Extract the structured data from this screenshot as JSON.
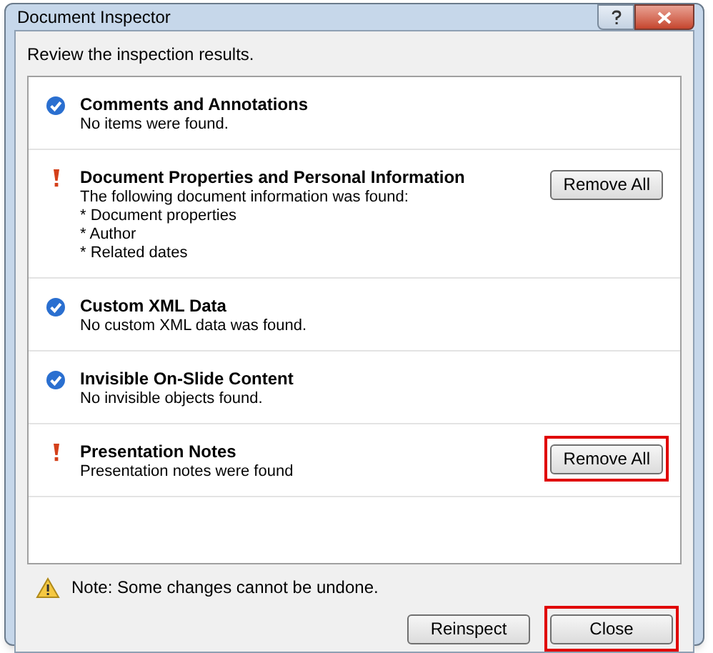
{
  "window": {
    "title": "Document Inspector"
  },
  "instruction": "Review the inspection results.",
  "results": [
    {
      "kind": "ok",
      "title": "Comments and Annotations",
      "details": [
        "No items were found."
      ]
    },
    {
      "kind": "found",
      "title": "Document Properties and Personal Information",
      "details": [
        "The following document information was found:",
        "* Document properties",
        "* Author",
        "* Related dates"
      ],
      "button": {
        "label": "Remove All",
        "highlighted": false
      }
    },
    {
      "kind": "ok",
      "title": "Custom XML Data",
      "details": [
        "No custom XML data was found."
      ]
    },
    {
      "kind": "ok",
      "title": "Invisible On-Slide Content",
      "details": [
        "No invisible objects found."
      ]
    },
    {
      "kind": "found",
      "title": "Presentation Notes",
      "details": [
        "Presentation notes were found"
      ],
      "button": {
        "label": "Remove All",
        "highlighted": true
      }
    }
  ],
  "note": "Note: Some changes cannot be undone.",
  "buttons": [
    {
      "label": "Reinspect",
      "highlighted": false
    },
    {
      "label": "Close",
      "highlighted": true
    }
  ]
}
